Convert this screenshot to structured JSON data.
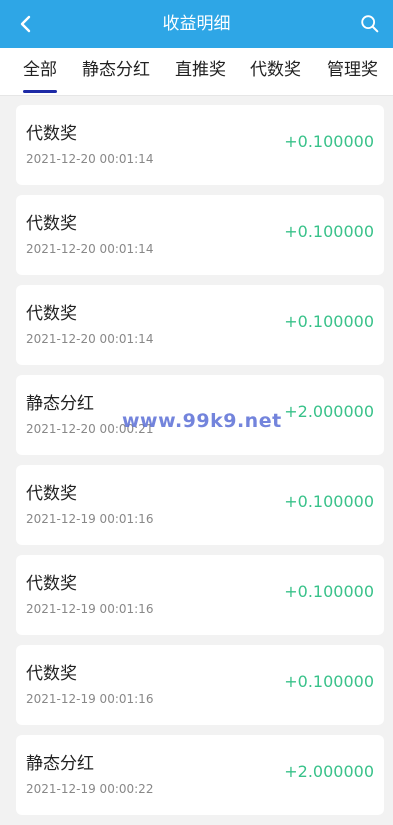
{
  "header": {
    "title": "收益明细",
    "back_icon": "chevron-left-icon",
    "search_icon": "search-icon"
  },
  "tabs": [
    {
      "label": "全部",
      "active": true
    },
    {
      "label": "静态分红",
      "active": false
    },
    {
      "label": "直推奖",
      "active": false
    },
    {
      "label": "代数奖",
      "active": false
    },
    {
      "label": "管理奖",
      "active": false
    }
  ],
  "records": [
    {
      "name": "代数奖",
      "time": "2021-12-20 00:01:14",
      "amount": "+0.100000"
    },
    {
      "name": "代数奖",
      "time": "2021-12-20 00:01:14",
      "amount": "+0.100000"
    },
    {
      "name": "代数奖",
      "time": "2021-12-20 00:01:14",
      "amount": "+0.100000"
    },
    {
      "name": "静态分红",
      "time": "2021-12-20 00:00:21",
      "amount": "+2.000000"
    },
    {
      "name": "代数奖",
      "time": "2021-12-19 00:01:16",
      "amount": "+0.100000"
    },
    {
      "name": "代数奖",
      "time": "2021-12-19 00:01:16",
      "amount": "+0.100000"
    },
    {
      "name": "代数奖",
      "time": "2021-12-19 00:01:16",
      "amount": "+0.100000"
    },
    {
      "name": "静态分红",
      "time": "2021-12-19 00:00:22",
      "amount": "+2.000000"
    }
  ],
  "watermark": "www.99k9.net",
  "colors": {
    "header": "#2ea6e6",
    "amount": "#39c28a",
    "tab_indicator": "#1d2aa6"
  }
}
